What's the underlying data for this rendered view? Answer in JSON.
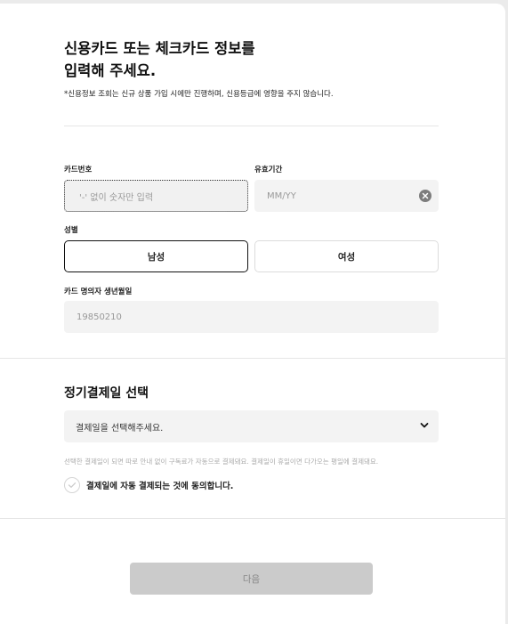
{
  "header": {
    "title_line1": "신용카드 또는 체크카드 정보를",
    "title_line2": "입력해 주세요.",
    "subtitle": "*신용정보 조회는 신규 상품 가입 시에만 진행하며, 신용등급에 영향을 주지 않습니다."
  },
  "card_number": {
    "label": "카드번호",
    "placeholder": "'-' 없이 숫자만 입력"
  },
  "expiry": {
    "label": "유효기간",
    "placeholder": "MM/YY"
  },
  "gender": {
    "label": "성별",
    "male": "남성",
    "female": "여성",
    "selected": "male"
  },
  "birthdate": {
    "label": "카드 명의자 생년월일",
    "placeholder": "19850210"
  },
  "billing": {
    "title": "정기결제일 선택",
    "select_placeholder": "결제일을 선택해주세요.",
    "notice": "선택한 결제일이 되면 따로 안내 없이 구독료가 자동으로 결제돼요. 결제일이 휴일이면 다가오는 평일에 결제돼요.",
    "agree_label": "결제일에 자동 결제되는 것에 동의합니다.",
    "agreed": false
  },
  "footer": {
    "next_label": "다음"
  },
  "icons": {
    "clear": "clear-icon",
    "chevron": "chevron-down-icon",
    "check": "check-icon"
  },
  "colors": {
    "page_bg": "#ebebeb",
    "field_bg": "#f3f3f3",
    "button_disabled": "#cbcbcb"
  }
}
